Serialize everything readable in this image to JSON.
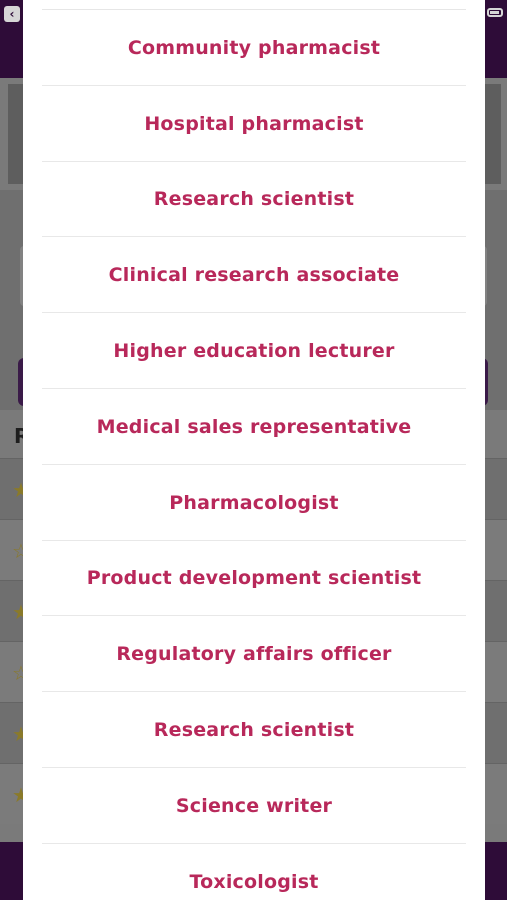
{
  "picker": {
    "options": [
      {
        "label": "Community pharmacist"
      },
      {
        "label": "Hospital pharmacist"
      },
      {
        "label": "Research scientist"
      },
      {
        "label": "Clinical research associate"
      },
      {
        "label": "Higher education lecturer"
      },
      {
        "label": "Medical sales representative"
      },
      {
        "label": "Pharmacologist"
      },
      {
        "label": "Product development scientist"
      },
      {
        "label": "Regulatory affairs officer"
      },
      {
        "label": "Research scientist"
      },
      {
        "label": "Science writer"
      },
      {
        "label": "Toxicologist"
      }
    ]
  },
  "background": {
    "heading_partial": "R",
    "back_icon": "back-arrow-icon",
    "battery_icon": "battery-icon"
  },
  "colors": {
    "option_text": "#b8285a",
    "sheet_background": "#ffffff",
    "app_bar": "#2e0c38",
    "overlay_dim": "#7a7a7a"
  }
}
